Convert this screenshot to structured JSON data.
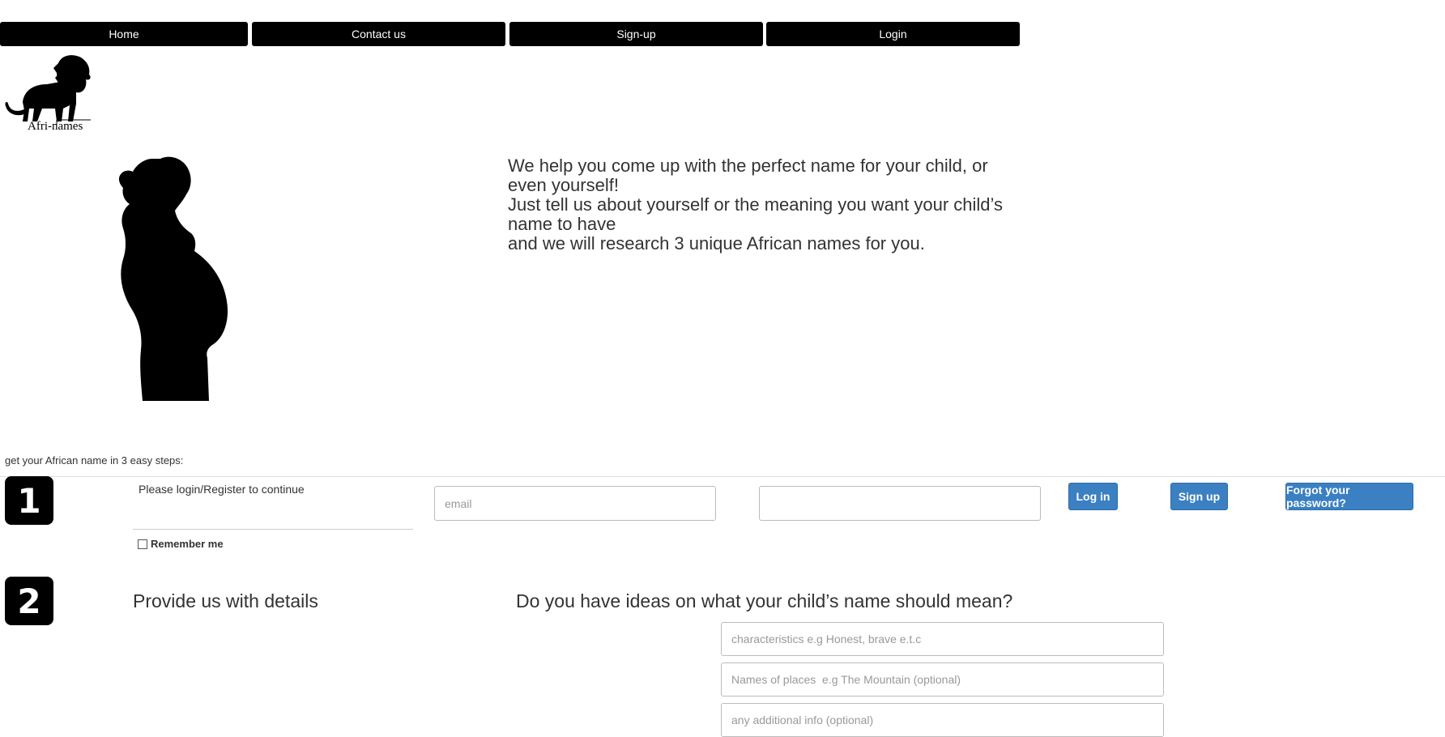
{
  "nav": {
    "items": [
      {
        "label": "Home"
      },
      {
        "label": "Contact us"
      },
      {
        "label": "Sign-up"
      },
      {
        "label": "Login"
      }
    ]
  },
  "logo": {
    "text": "Afri-names",
    "icon": "lion-icon"
  },
  "hero": {
    "image": "pregnant-woman-silhouette",
    "lines": [
      "We help you come up with the perfect name for your child, or",
      "even yourself!",
      "Just tell us about yourself or the meaning you want your child’s",
      "name to have",
      "and we will research 3 unique African names for you."
    ]
  },
  "steps": {
    "intro": "get your African name in 3 easy steps:",
    "step1": {
      "number": "1",
      "prompt": "Please login/Register to continue",
      "email_placeholder": "email",
      "password_value": "",
      "login_label": "Log in",
      "signup_label": "Sign up",
      "forgot_label": "Forgot your password?",
      "remember_label": "Remember me",
      "remember_checked": false
    },
    "step2": {
      "number": "2",
      "title": "Provide us with details",
      "question": "Do you have ideas on what your child’s name should mean?",
      "characteristics_placeholder": "characteristics e.g Honest, brave e.t.c",
      "places_placeholder": "Names of places  e.g The Mountain (optional)",
      "additional_placeholder": "any additional info (optional)"
    }
  },
  "colors": {
    "nav_bg": "#000000",
    "button_blue": "#3a80c2",
    "text": "#333333"
  }
}
